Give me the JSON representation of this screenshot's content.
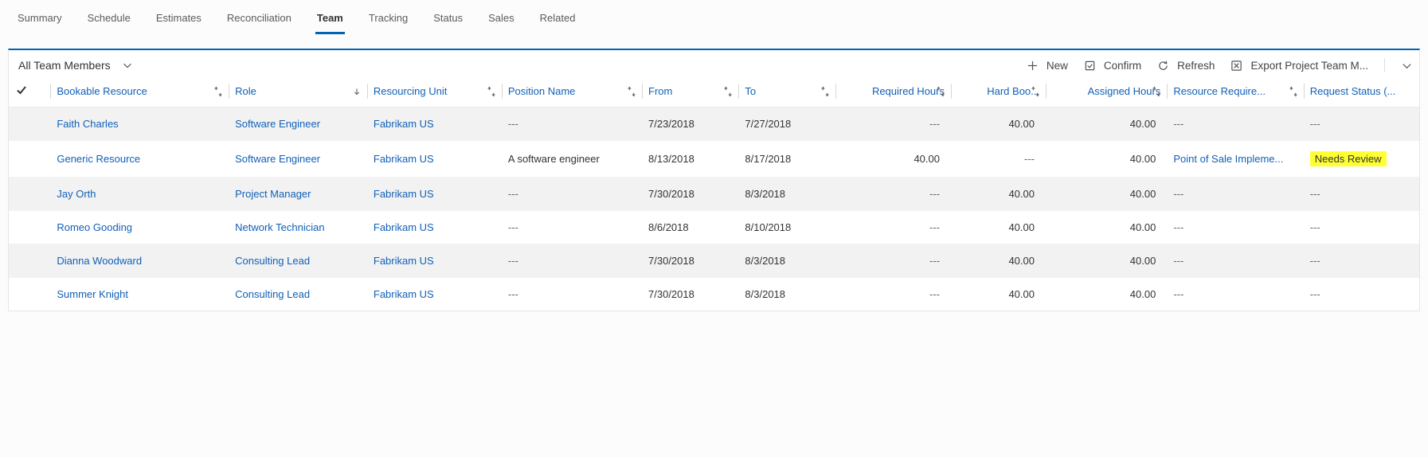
{
  "tabs": {
    "items": [
      "Summary",
      "Schedule",
      "Estimates",
      "Reconciliation",
      "Team",
      "Tracking",
      "Status",
      "Sales",
      "Related"
    ],
    "active": "Team"
  },
  "view": {
    "title": "All Team Members"
  },
  "commands": {
    "new": "New",
    "confirm": "Confirm",
    "refresh": "Refresh",
    "export": "Export Project Team M..."
  },
  "columns": {
    "resource": "Bookable Resource",
    "role": "Role",
    "unit": "Resourcing Unit",
    "position": "Position Name",
    "from": "From",
    "to": "To",
    "required": "Required Hours",
    "hard": "Hard Boo...",
    "assigned": "Assigned Hours",
    "rreq": "Resource Require...",
    "status": "Request Status (..."
  },
  "rows": [
    {
      "resource": "Faith Charles",
      "role": "Software Engineer",
      "unit": "Fabrikam US",
      "position": "---",
      "from": "7/23/2018",
      "to": "7/27/2018",
      "required": "---",
      "hard": "40.00",
      "assigned": "40.00",
      "rreq": "---",
      "status": "---",
      "highlight": false
    },
    {
      "resource": "Generic Resource",
      "role": "Software Engineer",
      "unit": "Fabrikam US",
      "position": "A software engineer",
      "from": "8/13/2018",
      "to": "8/17/2018",
      "required": "40.00",
      "hard": "---",
      "assigned": "40.00",
      "rreq": "Point of Sale Impleme...",
      "status": "Needs Review",
      "highlight": true
    },
    {
      "resource": "Jay Orth",
      "role": "Project Manager",
      "unit": "Fabrikam US",
      "position": "---",
      "from": "7/30/2018",
      "to": "8/3/2018",
      "required": "---",
      "hard": "40.00",
      "assigned": "40.00",
      "rreq": "---",
      "status": "---",
      "highlight": false
    },
    {
      "resource": "Romeo Gooding",
      "role": "Network Technician",
      "unit": "Fabrikam US",
      "position": "---",
      "from": "8/6/2018",
      "to": "8/10/2018",
      "required": "---",
      "hard": "40.00",
      "assigned": "40.00",
      "rreq": "---",
      "status": "---",
      "highlight": false
    },
    {
      "resource": "Dianna Woodward",
      "role": "Consulting Lead",
      "unit": "Fabrikam US",
      "position": "---",
      "from": "7/30/2018",
      "to": "8/3/2018",
      "required": "---",
      "hard": "40.00",
      "assigned": "40.00",
      "rreq": "---",
      "status": "---",
      "highlight": false
    },
    {
      "resource": "Summer Knight",
      "role": "Consulting Lead",
      "unit": "Fabrikam US",
      "position": "---",
      "from": "7/30/2018",
      "to": "8/3/2018",
      "required": "---",
      "hard": "40.00",
      "assigned": "40.00",
      "rreq": "---",
      "status": "---",
      "highlight": false
    }
  ]
}
